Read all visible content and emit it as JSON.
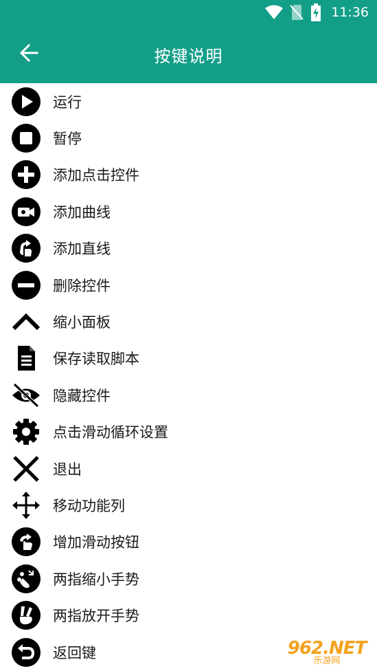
{
  "status_bar": {
    "time": "11:36",
    "icons": [
      "wifi-icon",
      "no-sim-icon",
      "battery-charging-icon"
    ]
  },
  "app_bar": {
    "title": "按键说明",
    "back_icon": "arrow-back-icon"
  },
  "items": [
    {
      "label": "运行",
      "icon": "play-icon"
    },
    {
      "label": "暂停",
      "icon": "stop-icon"
    },
    {
      "label": "添加点击控件",
      "icon": "add-circle-icon"
    },
    {
      "label": "添加曲线",
      "icon": "camera-icon"
    },
    {
      "label": "添加直线",
      "icon": "swipe-gesture-icon"
    },
    {
      "label": "删除控件",
      "icon": "remove-circle-icon"
    },
    {
      "label": "缩小面板",
      "icon": "chevron-up-icon"
    },
    {
      "label": "保存读取脚本",
      "icon": "document-icon"
    },
    {
      "label": "隐藏控件",
      "icon": "eye-off-icon"
    },
    {
      "label": "点击滑动循环设置",
      "icon": "gear-icon"
    },
    {
      "label": "退出",
      "icon": "close-icon"
    },
    {
      "label": "移动功能列",
      "icon": "move-arrows-icon"
    },
    {
      "label": "增加滑动按钮",
      "icon": "swipe-hand-icon"
    },
    {
      "label": "两指缩小手势",
      "icon": "pinch-in-icon"
    },
    {
      "label": "两指放开手势",
      "icon": "pinch-out-icon"
    },
    {
      "label": "返回键",
      "icon": "undo-icon"
    }
  ],
  "watermark": {
    "brand": "962.NET",
    "site": "乐游网"
  },
  "colors": {
    "primary": "#139e88",
    "icon": "#000000",
    "text": "#1a1a1a",
    "watermark": "#f4a21f"
  }
}
